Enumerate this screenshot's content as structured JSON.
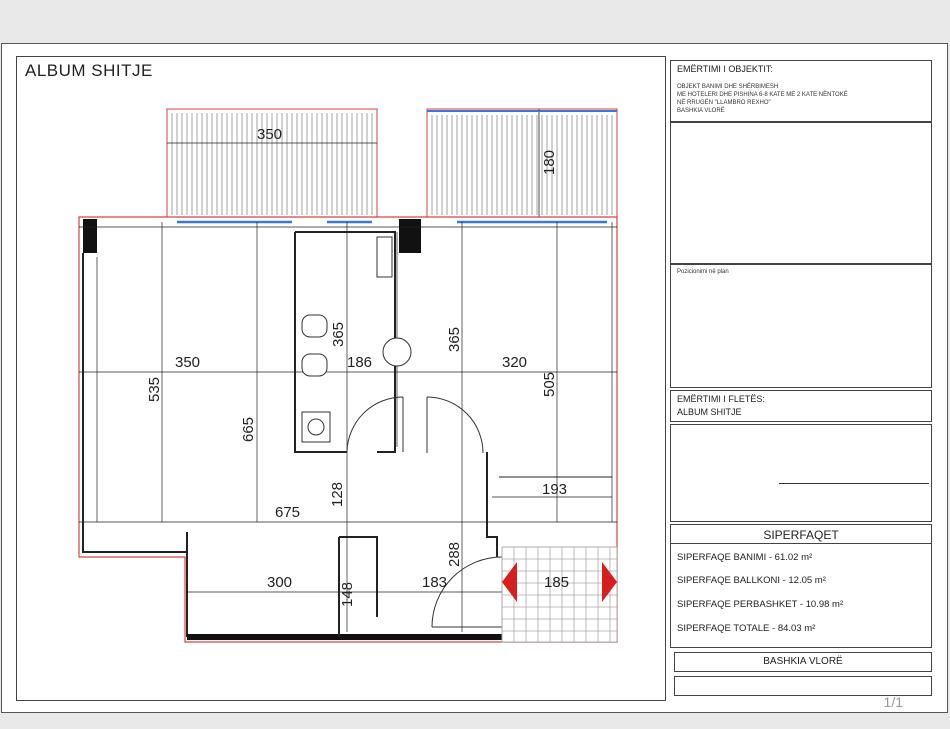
{
  "album_title": "ALBUM SHITJE",
  "dimensions": {
    "balcony_left_width": "350",
    "balcony_right_depth": "180",
    "living_width": "350",
    "bath_width": "186",
    "bedroom_width": "320",
    "living_height": "535",
    "hall_height": "665",
    "bath_height": "365",
    "bedroom_left_height": "365",
    "bedroom_right_height": "505",
    "total_width": "675",
    "corridor_width": "193",
    "passage_height": "128",
    "stair_height": "288",
    "lower_left_width": "300",
    "lower_left_height": "148",
    "door_width": "183",
    "stair_width": "185"
  },
  "title_block": {
    "object_label": "EMËRTIMI I OBJEKTIT:",
    "object_lines": [
      "OBJEKT BANIMI DHE SHËRBIMESH",
      "ME HOTELERI DHE PISHINA 6-8 KATE ME 2 KATE NËNTOKË",
      "NË RRUGËN \"LLAMBRO REXHO\"",
      "BASHKIA VLORË"
    ],
    "position_label": "Pozicionimi në plan",
    "sheet_label": "EMËRTIMI I FLETËS:",
    "sheet_name": "ALBUM SHITJE",
    "areas_title": "SIPERFAQET",
    "areas": [
      "SIPERFAQE BANIMI - 61.02 m²",
      "SIPERFAQE BALLKONI - 12.05 m²",
      "SIPERFAQE PERBASHKET - 10.98 m²",
      "SIPERFAQE TOTALE - 84.03 m²"
    ],
    "municipality": "BASHKIA VLORË",
    "page": "1/1"
  },
  "colors": {
    "wall": "#111111",
    "outline": "#d94040",
    "dimension": "#222222",
    "arrow": "#d81f1f",
    "window": "#3a78d6"
  }
}
